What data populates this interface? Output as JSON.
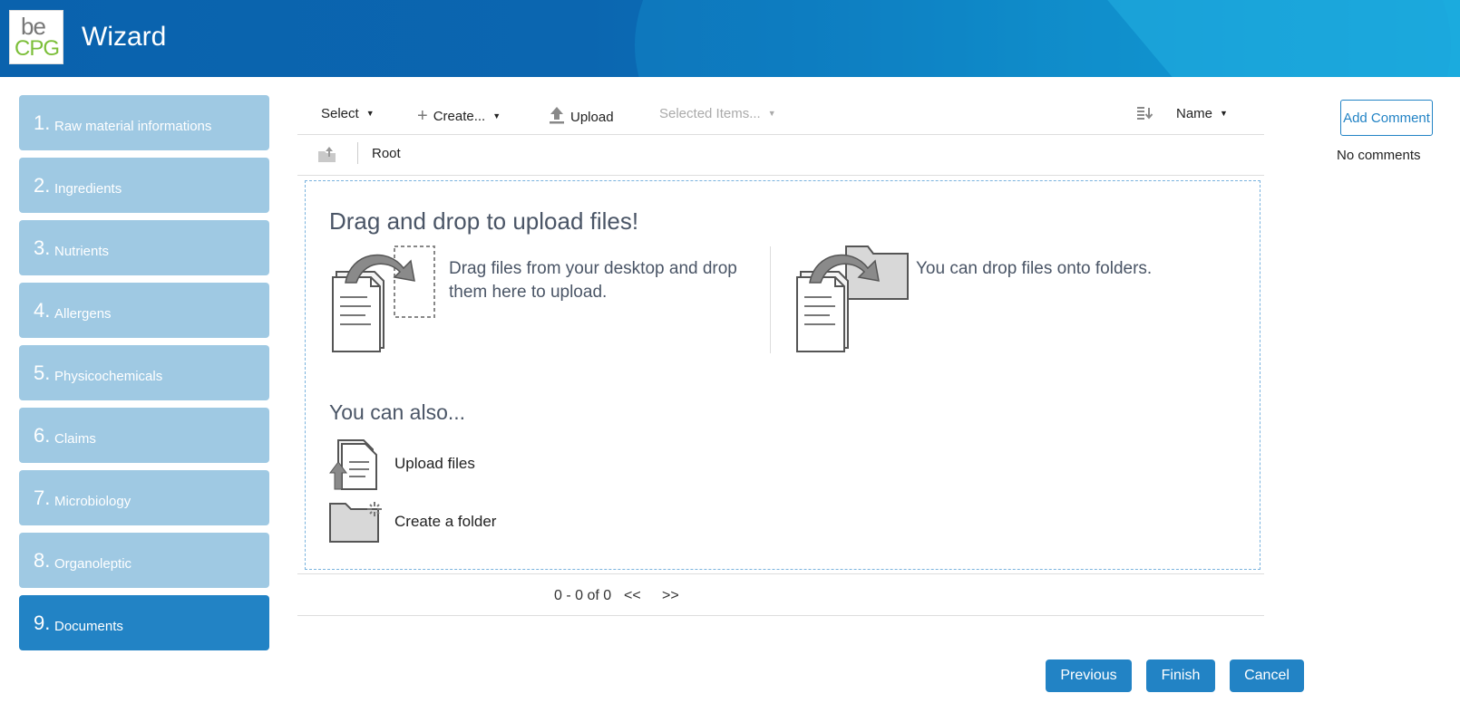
{
  "header": {
    "logo_top": "be",
    "logo_bottom": "CPG",
    "title": "Wizard"
  },
  "steps": [
    {
      "num": "1.",
      "label": "Raw material informations",
      "active": false
    },
    {
      "num": "2.",
      "label": "Ingredients",
      "active": false
    },
    {
      "num": "3.",
      "label": "Nutrients",
      "active": false
    },
    {
      "num": "4.",
      "label": "Allergens",
      "active": false
    },
    {
      "num": "5.",
      "label": "Physicochemicals",
      "active": false
    },
    {
      "num": "6.",
      "label": "Claims",
      "active": false
    },
    {
      "num": "7.",
      "label": "Microbiology",
      "active": false
    },
    {
      "num": "8.",
      "label": "Organoleptic",
      "active": false
    },
    {
      "num": "9.",
      "label": "Documents",
      "active": true
    }
  ],
  "toolbar": {
    "select": "Select",
    "create": "Create...",
    "upload": "Upload",
    "selected_items": "Selected Items...",
    "sort_field": "Name"
  },
  "path": {
    "root": "Root"
  },
  "dropzone": {
    "title": "Drag and drop to upload files!",
    "text1": "Drag files from your desktop and drop them here to upload.",
    "text2": "You can drop files onto folders.",
    "also_title": "You can also...",
    "upload_files": "Upload files",
    "create_folder": "Create a folder"
  },
  "pager": {
    "count": "0 - 0 of 0",
    "prev": "<<",
    "next": ">>"
  },
  "comments": {
    "add": "Add Comment",
    "none": "No comments"
  },
  "footer": {
    "previous": "Previous",
    "finish": "Finish",
    "cancel": "Cancel"
  },
  "colors": {
    "accent": "#2283c5",
    "step_inactive": "#9fc9e3",
    "header": "#0a62ad"
  }
}
